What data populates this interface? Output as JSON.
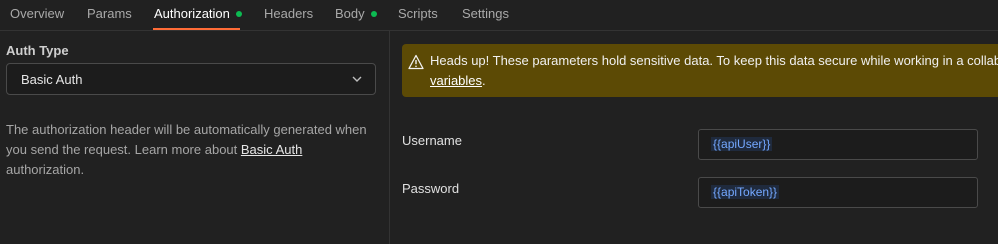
{
  "tabs": [
    {
      "label": "Overview",
      "active": false,
      "dot": false
    },
    {
      "label": "Params",
      "active": false,
      "dot": false
    },
    {
      "label": "Authorization",
      "active": true,
      "dot": true
    },
    {
      "label": "Headers",
      "active": false,
      "dot": false
    },
    {
      "label": "Body",
      "active": false,
      "dot": true
    },
    {
      "label": "Scripts",
      "active": false,
      "dot": false
    },
    {
      "label": "Settings",
      "active": false,
      "dot": false
    }
  ],
  "auth": {
    "type_label": "Auth Type",
    "selected": "Basic Auth",
    "help_prefix": "The authorization header will be automatically generated when you send the request. Learn more about ",
    "help_link": "Basic Auth",
    "help_suffix": " authorization."
  },
  "banner": {
    "text": "Heads up! These parameters hold sensitive data. To keep this data secure while working in a collabo",
    "link": "variables",
    "tail": "."
  },
  "fields": {
    "username_label": "Username",
    "username_value": "{{apiUser}}",
    "password_label": "Password",
    "password_value": "{{apiToken}}"
  },
  "colors": {
    "accent": "#ff6c37",
    "dot": "#0cbb52",
    "banner_bg": "#5c4a05",
    "variable": "#74a8ff"
  }
}
